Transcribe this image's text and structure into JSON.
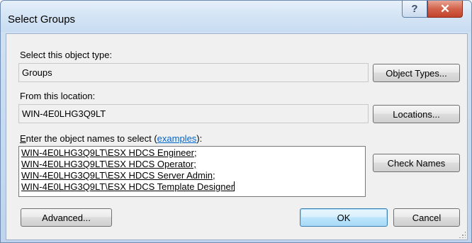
{
  "window": {
    "title": "Select Groups"
  },
  "titlebar": {
    "help_glyph": "?",
    "close_glyph": "✕"
  },
  "object_type": {
    "label": "Select this object type:",
    "value": "Groups",
    "button": "Object Types..."
  },
  "location": {
    "label": "From this location:",
    "value": "WIN-4E0LHG3Q9LT",
    "button": "Locations..."
  },
  "names": {
    "label_prefix": "nter the object names to select (",
    "label_accel": "E",
    "label_link": "examples",
    "label_suffix": "):",
    "lines": [
      "WIN-4E0LHG3Q9LT\\ESX HDCS Engineer;",
      "WIN-4E0LHG3Q9LT\\ESX HDCS Operator;",
      "WIN-4E0LHG3Q9LT\\ESX HDCS Server Admin;",
      "WIN-4E0LHG3Q9LT\\ESX HDCS Template Designer"
    ],
    "check_button": "Check Names"
  },
  "footer": {
    "advanced_button": "Advanced...",
    "ok_button": "OK",
    "cancel_button": "Cancel"
  }
}
